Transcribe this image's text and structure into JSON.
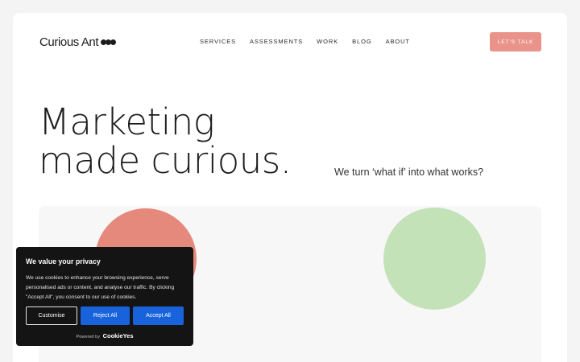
{
  "brand": {
    "name": "Curious Ant",
    "dots_icon": "three-dots-icon"
  },
  "nav": {
    "items": [
      {
        "label": "SERVICES"
      },
      {
        "label": "ASSESSMENTS"
      },
      {
        "label": "WORK"
      },
      {
        "label": "BLOG"
      },
      {
        "label": "ABOUT"
      }
    ]
  },
  "cta": {
    "label": "LET'S TALK"
  },
  "hero": {
    "line1": "Marketing",
    "line2": "made curious.",
    "tagline": "We turn ‘what if’ into what works?"
  },
  "colors": {
    "accent": "#e9938a",
    "circle_pink": "#e5897c",
    "circle_green": "#c4e2b8",
    "cookie_bg": "#141414",
    "cookie_button_blue": "#1863dc"
  },
  "cookie": {
    "title": "We value your privacy",
    "text": "We use cookies to enhance your browsing experience, serve personalised ads or content, and analyse our traffic. By clicking \"Accept All\", you consent to our use of cookies.",
    "buttons": {
      "customise": "Customise",
      "reject": "Reject All",
      "accept": "Accept All"
    },
    "powered_by": "Powered by",
    "brand": "CookieYes"
  }
}
